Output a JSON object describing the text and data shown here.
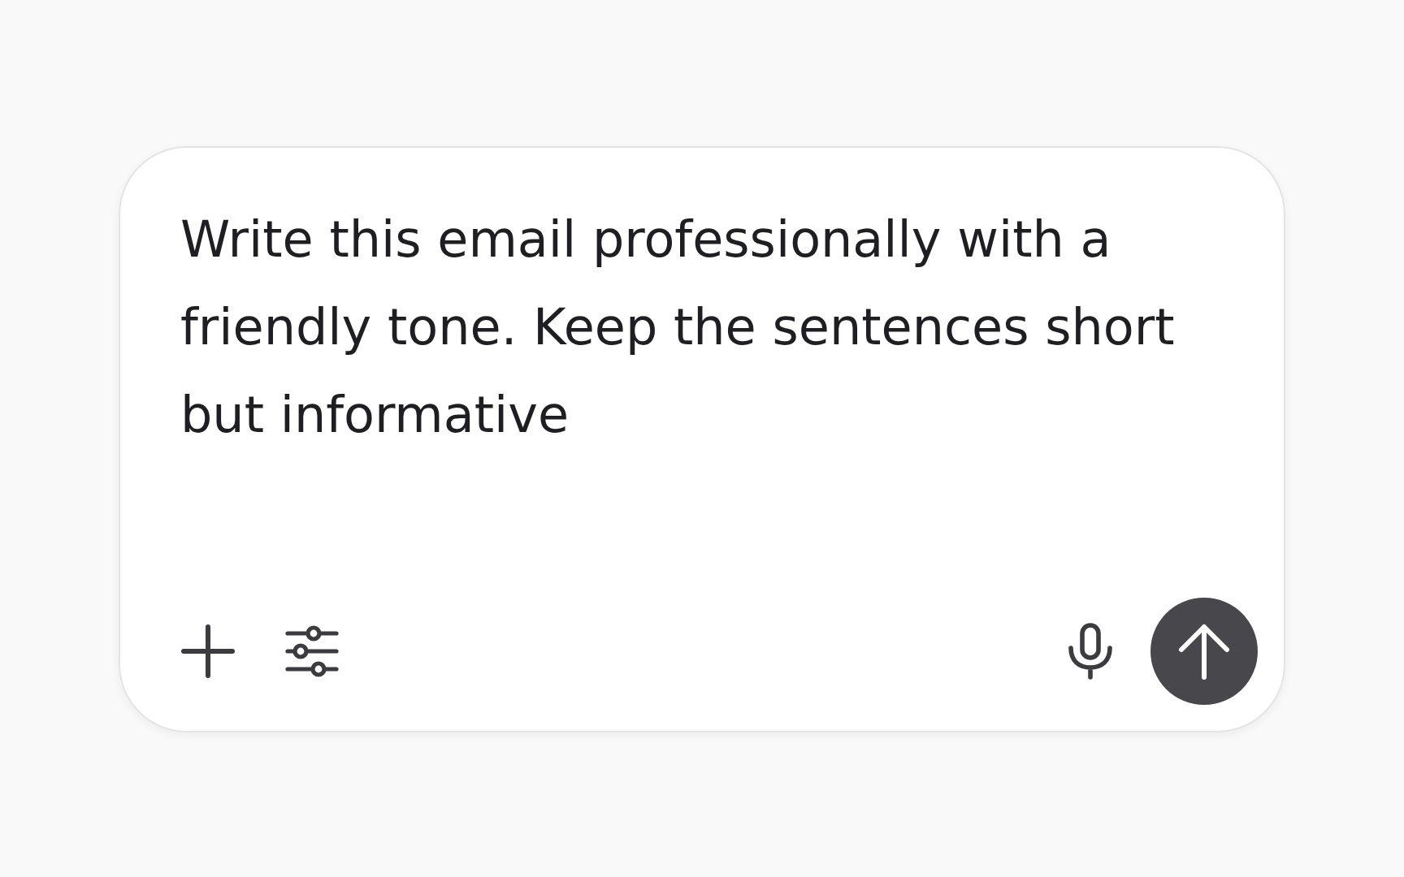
{
  "prompt": {
    "value": "Write this email professionally with a friendly tone. Keep the sentences short but informative"
  }
}
